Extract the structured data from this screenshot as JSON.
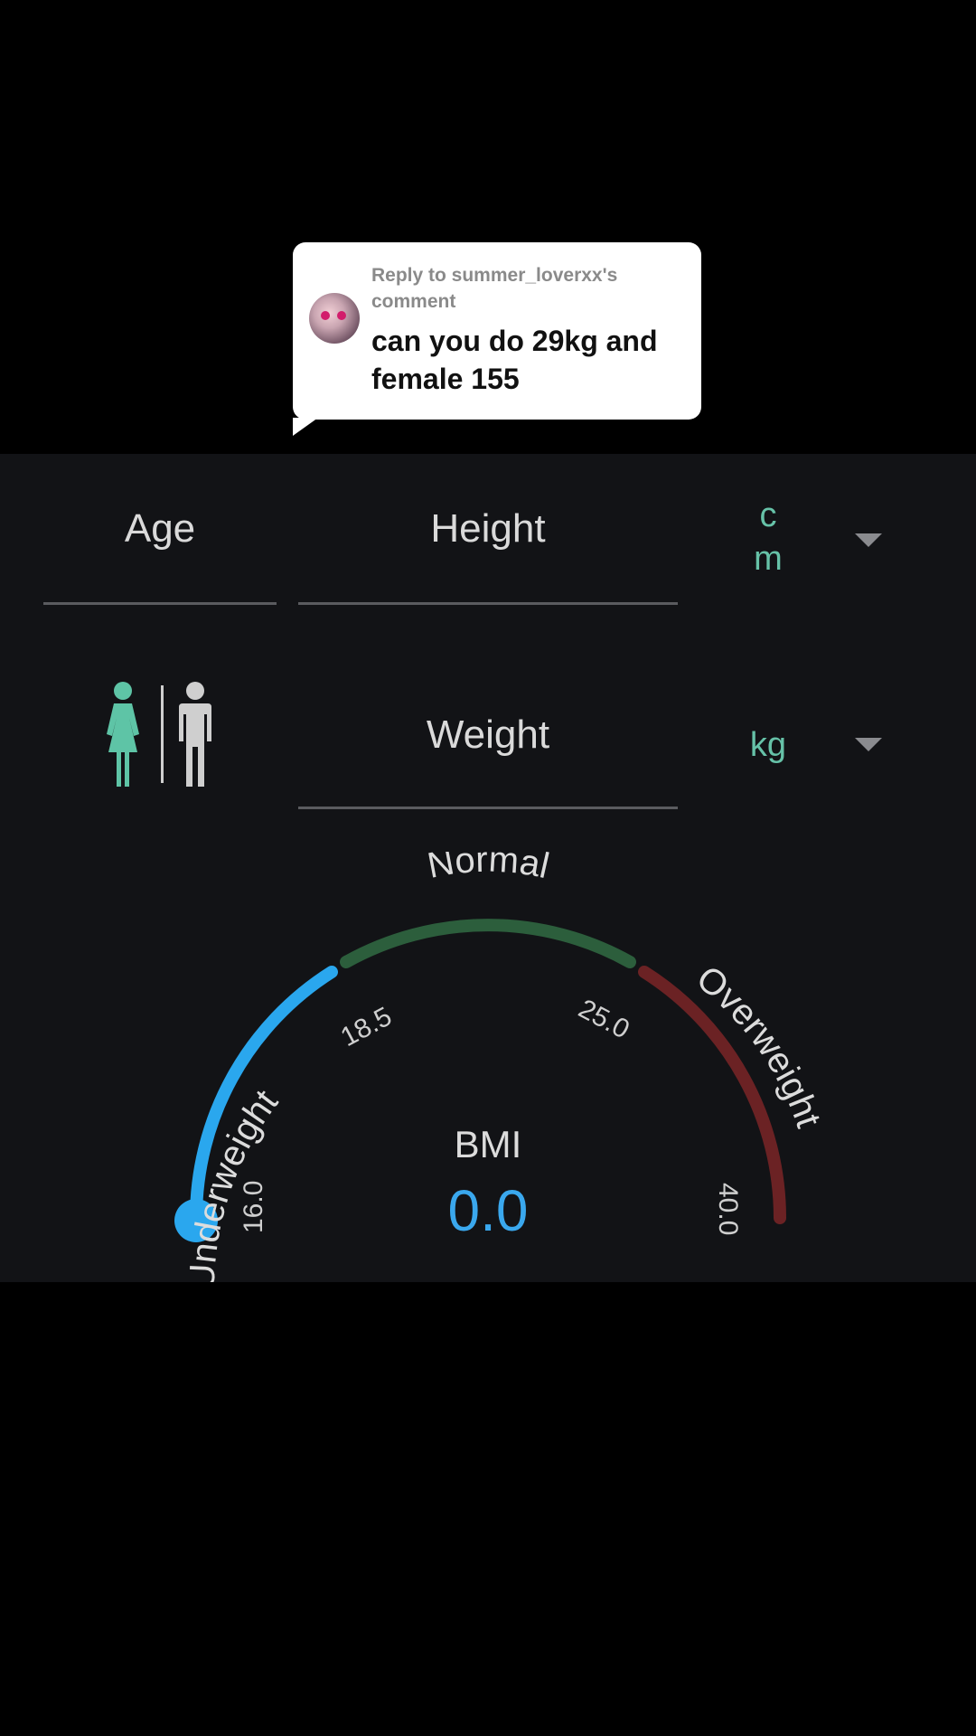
{
  "reply": {
    "meta": "Reply to summer_loverxx's comment",
    "text": "can you do 29kg and female 155"
  },
  "form": {
    "age_label": "Age",
    "height_label": "Height",
    "height_unit": "cm",
    "weight_label": "Weight",
    "weight_unit": "kg",
    "gender_selected": "female"
  },
  "gauge": {
    "category_underweight": "Underweight",
    "category_normal": "Normal",
    "category_overweight": "Overweight",
    "tick_16": "16.0",
    "tick_18_5": "18.5",
    "tick_25": "25.0",
    "tick_40": "40.0",
    "bmi_label": "BMI",
    "bmi_value": "0.0",
    "colors": {
      "underweight": "#2aa7ee",
      "normal": "#2c5e3c",
      "overweight": "#6b2224",
      "accent": "#66c2a8"
    }
  }
}
